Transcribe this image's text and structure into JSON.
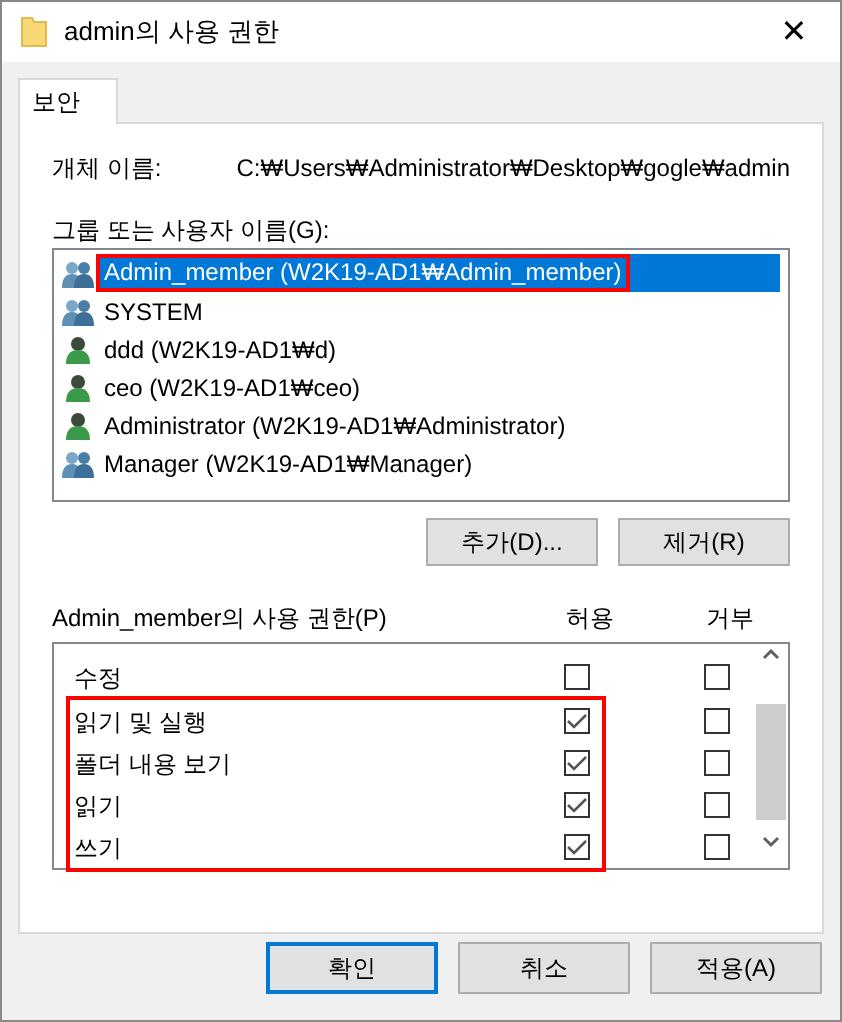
{
  "window": {
    "title": "admin의 사용 권한",
    "close": "✕"
  },
  "tabs": [
    {
      "label": "보안",
      "selected": true
    }
  ],
  "object_name": {
    "label": "개체 이름:",
    "value": "C:₩Users₩Administrator₩Desktop₩gogle₩admin"
  },
  "users_label": "그룹 또는 사용자 이름(G):",
  "users": [
    {
      "name": "Admin_member (W2K19-AD1₩Admin_member)",
      "kind": "group",
      "selected": true,
      "highlighted": true
    },
    {
      "name": "SYSTEM",
      "kind": "group",
      "selected": false,
      "highlighted": false
    },
    {
      "name": "ddd (W2K19-AD1₩d)",
      "kind": "user",
      "selected": false,
      "highlighted": false
    },
    {
      "name": "ceo (W2K19-AD1₩ceo)",
      "kind": "user",
      "selected": false,
      "highlighted": false
    },
    {
      "name": "Administrator (W2K19-AD1₩Administrator)",
      "kind": "user",
      "selected": false,
      "highlighted": false
    },
    {
      "name": "Manager (W2K19-AD1₩Manager)",
      "kind": "group",
      "selected": false,
      "highlighted": false
    }
  ],
  "user_buttons": [
    "추가(D)...",
    "제거(R)"
  ],
  "permissions_label": "Admin_member의 사용 권한(P)",
  "permission_columns": [
    "허용",
    "거부"
  ],
  "permissions": [
    {
      "name": "수정",
      "allow": false,
      "deny": false,
      "highlighted": false
    },
    {
      "name": "읽기 및 실행",
      "allow": true,
      "deny": false,
      "highlighted": true
    },
    {
      "name": "폴더 내용 보기",
      "allow": true,
      "deny": false,
      "highlighted": true
    },
    {
      "name": "읽기",
      "allow": true,
      "deny": false,
      "highlighted": true
    },
    {
      "name": "쓰기",
      "allow": true,
      "deny": false,
      "highlighted": true
    }
  ],
  "dialog_buttons": [
    {
      "label": "확인",
      "default": true
    },
    {
      "label": "취소",
      "default": false
    },
    {
      "label": "적용(A)",
      "default": false
    }
  ]
}
